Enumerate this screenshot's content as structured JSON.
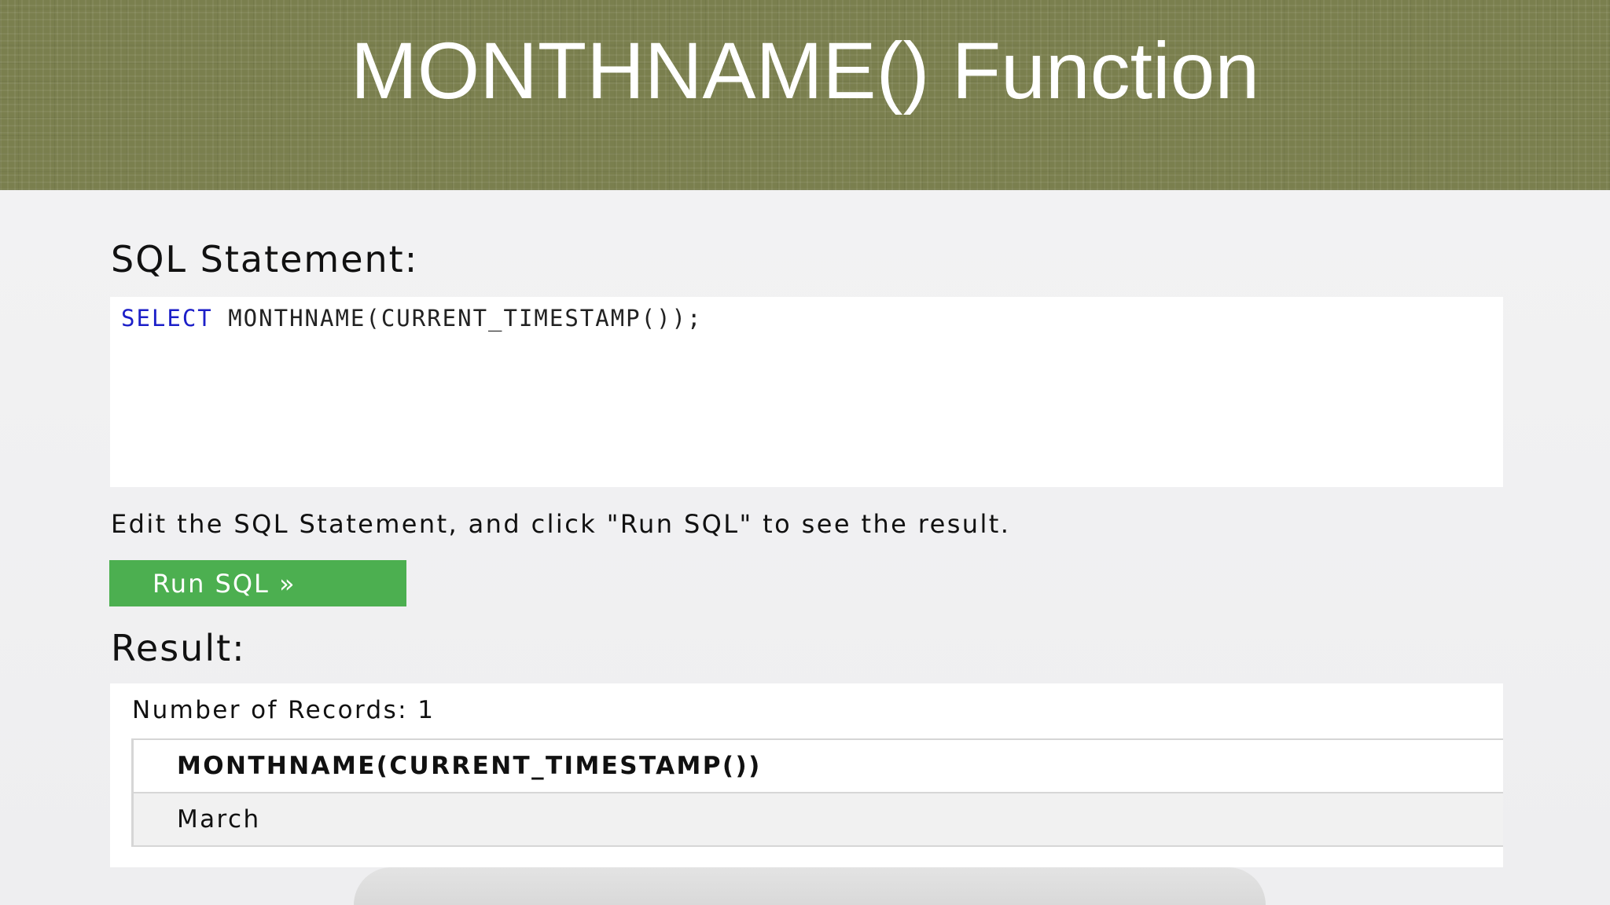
{
  "banner": {
    "title": "MONTHNAME() Function"
  },
  "sql_heading": "SQL Statement:",
  "editor": {
    "keyword": "SELECT",
    "code_rest": " MONTHNAME(CURRENT_TIMESTAMP());"
  },
  "hint": "Edit the SQL Statement, and click \"Run SQL\" to see the result.",
  "run_button": "Run SQL »",
  "result_heading": "Result:",
  "result": {
    "records": "Number of Records: 1",
    "columns": [
      "MONTHNAME(CURRENT_TIMESTAMP())"
    ],
    "rows": [
      [
        "March"
      ]
    ]
  },
  "colors": {
    "banner": "#7a7f4e",
    "button": "#4caf50",
    "keyword": "#1c1fc8"
  }
}
